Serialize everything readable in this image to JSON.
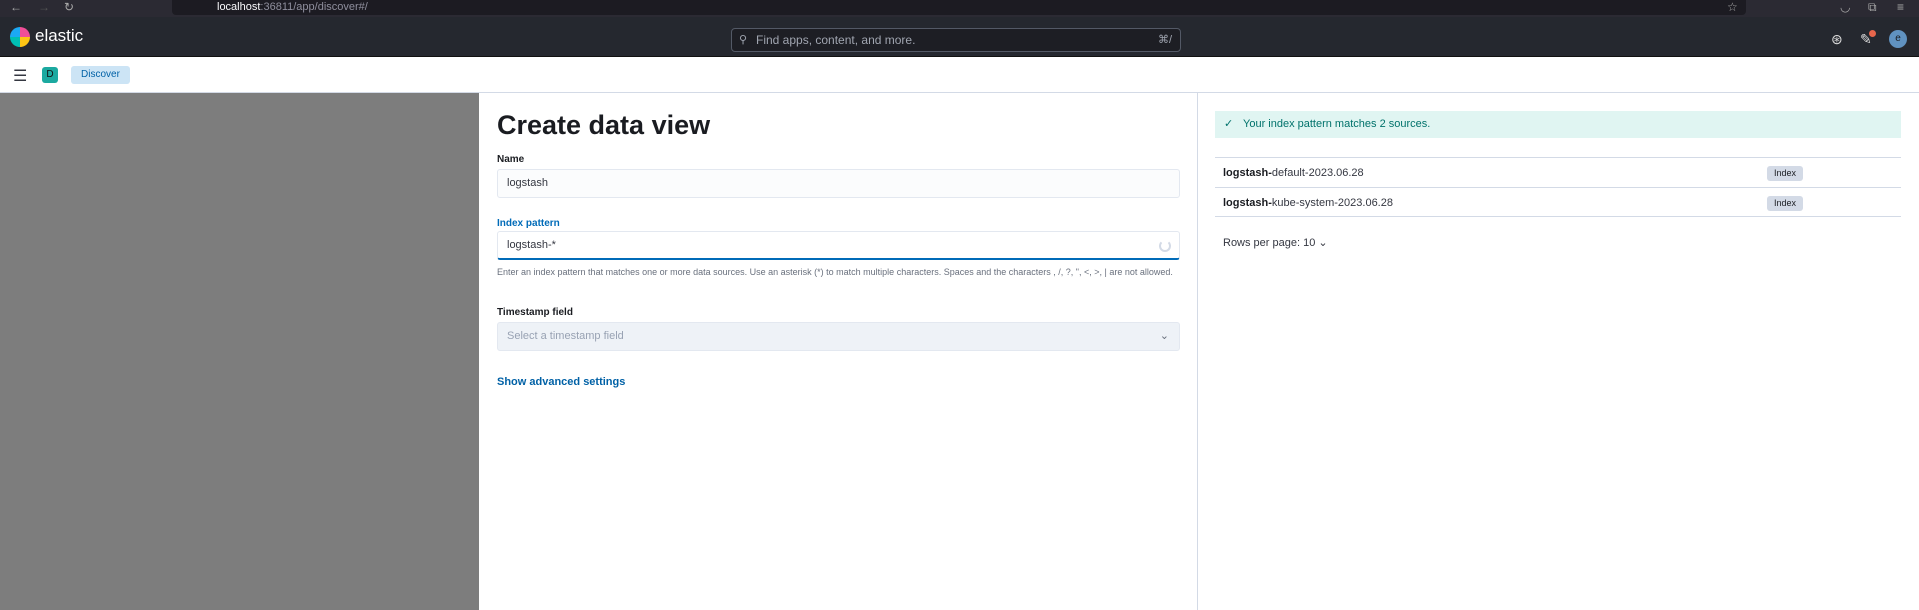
{
  "browser": {
    "url_host": "localhost",
    "url_rest": ":36811/app/discover#/"
  },
  "header": {
    "brand": "elastic",
    "search_placeholder": "Find apps, content, and more.",
    "search_shortcut": "⌘/",
    "avatar": "e"
  },
  "breadcrumb": {
    "space": "D",
    "current": "Discover"
  },
  "form": {
    "title": "Create data view",
    "name_label": "Name",
    "name_value": "logstash",
    "pattern_label": "Index pattern",
    "pattern_value": "logstash-*",
    "pattern_help": "Enter an index pattern that matches one or more data sources. Use an asterisk (*) to match multiple characters. Spaces and the characters , /, ?, \", <, >, | are not allowed.",
    "timestamp_label": "Timestamp field",
    "timestamp_placeholder": "Select a timestamp field",
    "advanced_link": "Show advanced settings"
  },
  "results": {
    "callout": "Your index pattern matches 2 sources.",
    "rows": [
      {
        "match": "logstash-",
        "rest": "default-2023.06.28",
        "type": "Index"
      },
      {
        "match": "logstash-",
        "rest": "kube-system-2023.06.28",
        "type": "Index"
      }
    ],
    "rows_per_page": "Rows per page: 10"
  }
}
